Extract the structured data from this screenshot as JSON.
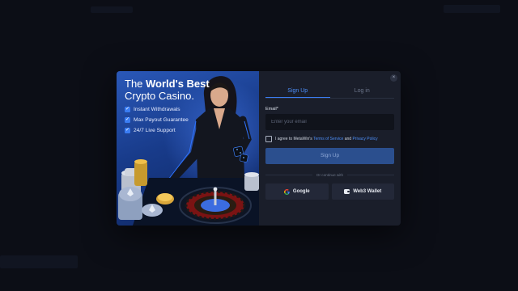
{
  "promo": {
    "title_line1_prefix": "The ",
    "title_line1_bold": "World's Best",
    "title_line2": "Crypto Casino.",
    "features": [
      "Instant Withdrawals",
      "Max Payout Guarantee",
      "24/7 Live Support"
    ]
  },
  "form": {
    "close_label": "×",
    "tabs": [
      {
        "label": "Sign Up",
        "active": true
      },
      {
        "label": "Log in",
        "active": false
      }
    ],
    "email_label": "Email*",
    "email_placeholder": "Enter your email",
    "email_value": "",
    "agree_prefix": "I agree to MetaWin's ",
    "terms_link": "Terms of Service",
    "agree_and": " and ",
    "privacy_link": "Privacy Policy",
    "submit_label": "Sign Up",
    "divider_text": "Or continue with",
    "google_label": "Google",
    "web3_label": "Web3 Wallet"
  },
  "colors": {
    "accent": "#3b7df2",
    "modal_bg": "#1a1e2a",
    "backdrop": "#0c0e16",
    "primary_button": "#2b4f8e"
  }
}
